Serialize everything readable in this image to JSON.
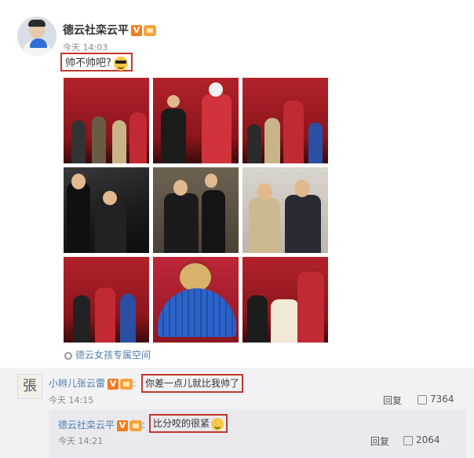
{
  "post": {
    "author": "德云社栾云平",
    "verified_badge": "V",
    "time": "今天 14:03",
    "text": "帅不帅吧?",
    "emoji_icon": "sunglasses-emoji-icon",
    "source": "德云女孩专属空间",
    "photo_count": 9
  },
  "comment": {
    "author": "小辫儿张云雷",
    "verified_badge": "V",
    "avatar_text": "張",
    "text": "你差一点儿就比我帅了",
    "time": "今天 14:15",
    "reply_label": "回复",
    "likes": "7364"
  },
  "reply": {
    "author": "德云社栾云平",
    "verified_badge": "V",
    "text": "比分咬的很紧",
    "emoji_icon": "smile-emoji-icon",
    "time": "今天 14:21",
    "reply_label": "回复",
    "likes": "2064"
  },
  "colors": {
    "highlight_border": "#c0392b",
    "link": "#507daf",
    "vip_badge": "#f37b1d"
  }
}
